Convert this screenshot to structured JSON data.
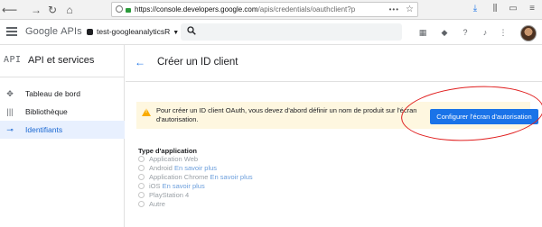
{
  "browser": {
    "url_domain": "https://console.developers.google.com",
    "url_path": "/apis/credentials/oauthclient?p",
    "url_dots": "•••"
  },
  "header": {
    "logo_google": "Google",
    "logo_apis": "APIs",
    "project": "test-googleanalyticsR"
  },
  "sidebar": {
    "api_badge": "API",
    "title": "API et services",
    "items": [
      {
        "label": "Tableau de bord"
      },
      {
        "label": "Bibliothèque"
      },
      {
        "label": "Identifiants"
      }
    ]
  },
  "main": {
    "title": "Créer un ID client",
    "alert": "Pour créer un ID client OAuth, vous devez d'abord définir un nom de produit sur l'écran d'autorisation.",
    "configure_button": "Configurer l'écran d'autorisation",
    "app_type_label": "Type d'application",
    "app_types": [
      {
        "label": "Application Web",
        "more": ""
      },
      {
        "label": "Android",
        "more": "En savoir plus"
      },
      {
        "label": "Application Chrome",
        "more": "En savoir plus"
      },
      {
        "label": "iOS",
        "more": "En savoir plus"
      },
      {
        "label": "PlayStation 4",
        "more": ""
      },
      {
        "label": "Autre",
        "more": ""
      }
    ]
  },
  "colors": {
    "accent": "#1a73e8",
    "alert_bg": "#fef7e0",
    "annotation_red": "#e01e1e"
  }
}
